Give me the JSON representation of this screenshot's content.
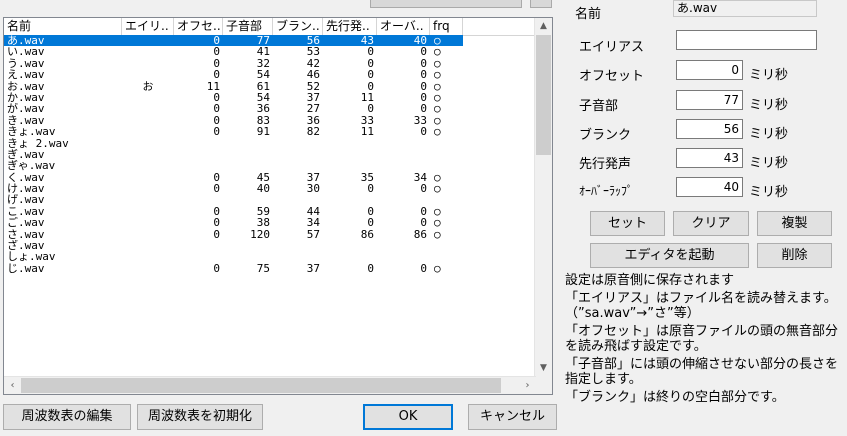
{
  "columns": [
    "名前",
    "エイリ..",
    "オフセ..",
    "子音部",
    "ブラン..",
    "先行発..",
    "オーバ..",
    "frq"
  ],
  "rows": [
    {
      "name": "あ.wav",
      "alias": "",
      "offset": "0",
      "consonant": "77",
      "blank": "56",
      "preutter": "43",
      "overlap": "40",
      "frq": "○",
      "selected": true
    },
    {
      "name": "い.wav",
      "alias": "",
      "offset": "0",
      "consonant": "41",
      "blank": "53",
      "preutter": "0",
      "overlap": "0",
      "frq": "○"
    },
    {
      "name": "う.wav",
      "alias": "",
      "offset": "0",
      "consonant": "32",
      "blank": "42",
      "preutter": "0",
      "overlap": "0",
      "frq": "○"
    },
    {
      "name": "え.wav",
      "alias": "",
      "offset": "0",
      "consonant": "54",
      "blank": "46",
      "preutter": "0",
      "overlap": "0",
      "frq": "○"
    },
    {
      "name": "お.wav",
      "alias": "お",
      "offset": "11",
      "consonant": "61",
      "blank": "52",
      "preutter": "0",
      "overlap": "0",
      "frq": "○"
    },
    {
      "name": "か.wav",
      "alias": "",
      "offset": "0",
      "consonant": "54",
      "blank": "37",
      "preutter": "11",
      "overlap": "0",
      "frq": "○"
    },
    {
      "name": "が.wav",
      "alias": "",
      "offset": "0",
      "consonant": "36",
      "blank": "27",
      "preutter": "0",
      "overlap": "0",
      "frq": "○"
    },
    {
      "name": "き.wav",
      "alias": "",
      "offset": "0",
      "consonant": "83",
      "blank": "36",
      "preutter": "33",
      "overlap": "33",
      "frq": "○"
    },
    {
      "name": "きょ.wav",
      "alias": "",
      "offset": "0",
      "consonant": "91",
      "blank": "82",
      "preutter": "11",
      "overlap": "0",
      "frq": "○"
    },
    {
      "name": "きょ_2.wav",
      "alias": "",
      "offset": "",
      "consonant": "",
      "blank": "",
      "preutter": "",
      "overlap": "",
      "frq": ""
    },
    {
      "name": "ぎ.wav",
      "alias": "",
      "offset": "",
      "consonant": "",
      "blank": "",
      "preutter": "",
      "overlap": "",
      "frq": ""
    },
    {
      "name": "ぎゃ.wav",
      "alias": "",
      "offset": "",
      "consonant": "",
      "blank": "",
      "preutter": "",
      "overlap": "",
      "frq": ""
    },
    {
      "name": "く.wav",
      "alias": "",
      "offset": "0",
      "consonant": "45",
      "blank": "37",
      "preutter": "35",
      "overlap": "34",
      "frq": "○"
    },
    {
      "name": "け.wav",
      "alias": "",
      "offset": "0",
      "consonant": "40",
      "blank": "30",
      "preutter": "0",
      "overlap": "0",
      "frq": "○"
    },
    {
      "name": "げ.wav",
      "alias": "",
      "offset": "",
      "consonant": "",
      "blank": "",
      "preutter": "",
      "overlap": "",
      "frq": ""
    },
    {
      "name": "こ.wav",
      "alias": "",
      "offset": "0",
      "consonant": "59",
      "blank": "44",
      "preutter": "0",
      "overlap": "0",
      "frq": "○"
    },
    {
      "name": "ご.wav",
      "alias": "",
      "offset": "0",
      "consonant": "38",
      "blank": "34",
      "preutter": "0",
      "overlap": "0",
      "frq": "○"
    },
    {
      "name": "さ.wav",
      "alias": "",
      "offset": "0",
      "consonant": "120",
      "blank": "57",
      "preutter": "86",
      "overlap": "86",
      "frq": "○"
    },
    {
      "name": "ざ.wav",
      "alias": "",
      "offset": "",
      "consonant": "",
      "blank": "",
      "preutter": "",
      "overlap": "",
      "frq": ""
    },
    {
      "name": "しょ.wav",
      "alias": "",
      "offset": "",
      "consonant": "",
      "blank": "",
      "preutter": "",
      "overlap": "",
      "frq": ""
    },
    {
      "name": "じ.wav",
      "alias": "",
      "offset": "0",
      "consonant": "75",
      "blank": "37",
      "preutter": "0",
      "overlap": "0",
      "frq": "○"
    }
  ],
  "bottom_buttons": {
    "edit_freq": "周波数表の編集",
    "init_freq": "周波数表を初期化",
    "ok": "OK",
    "cancel": "キャンセル"
  },
  "form": {
    "name_label": "名前",
    "name_value": "あ.wav",
    "alias_label": "エイリアス",
    "alias_value": "",
    "offset_label": "オフセット",
    "offset_value": "0",
    "consonant_label": "子音部",
    "consonant_value": "77",
    "blank_label": "ブランク",
    "blank_value": "56",
    "preutter_label": "先行発声",
    "preutter_value": "43",
    "overlap_label": "ｵｰﾊﾞｰﾗｯﾌﾟ",
    "overlap_value": "40",
    "unit": "ミリ秒"
  },
  "form_buttons": {
    "set": "セット",
    "clear": "クリア",
    "duplicate": "複製",
    "launch_editor": "エディタを起動",
    "delete": "削除"
  },
  "help_lines": [
    "設定は原音側に保存されます",
    "「エイリアス」はファイル名を読み替えます。（”sa.wav”→”さ”等）",
    "「オフセット」は原音ファイルの頭の無音部分を読み飛ばす設定です。",
    "「子音部」には頭の伸縮させない部分の長さを指定します。",
    "「ブランク」は終りの空白部分です。"
  ]
}
